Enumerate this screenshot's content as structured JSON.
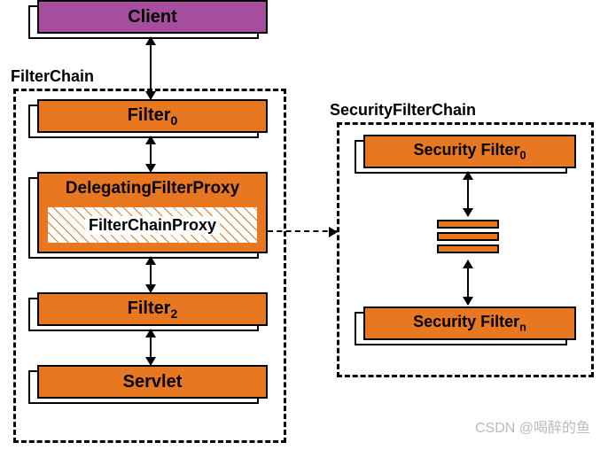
{
  "client": "Client",
  "filterChain": {
    "label": "FilterChain",
    "filter0": "Filter",
    "filter0_sub": "0",
    "delegating": "DelegatingFilterProxy",
    "proxy": "FilterChainProxy",
    "filter2": "Filter",
    "filter2_sub": "2",
    "servlet": "Servlet"
  },
  "securityChain": {
    "label": "SecurityFilterChain",
    "sf0": "Security Filter",
    "sf0_sub": "0",
    "sfn": "Security Filter",
    "sfn_sub": "n"
  },
  "watermark": "CSDN @喝醉的鱼"
}
